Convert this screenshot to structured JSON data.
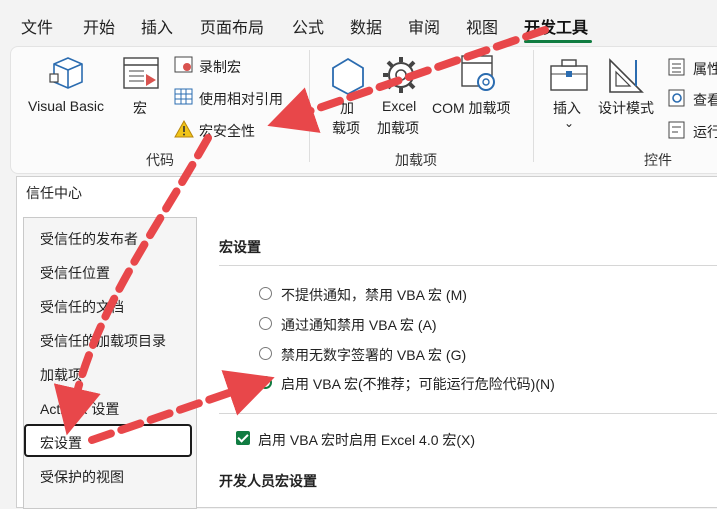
{
  "menubar": {
    "tabs": [
      "文件",
      "开始",
      "插入",
      "页面布局",
      "公式",
      "数据",
      "审阅",
      "视图",
      "开发工具"
    ],
    "active_tab": "开发工具"
  },
  "ribbon": {
    "code": {
      "visual_basic": "Visual Basic",
      "macros": "宏",
      "record_macro": "录制宏",
      "relative_ref": "使用相对引用",
      "macro_security": "宏安全性",
      "group_label": "代码"
    },
    "addins": {
      "addins_line1": "加",
      "addins_line2": "载项",
      "excel_addins_line1": "Excel",
      "excel_addins_line2": "加载项",
      "com_addins": "COM 加载项",
      "group_label": "加载项"
    },
    "controls": {
      "insert": "插入",
      "design_mode": "设计模式",
      "properties": "属性",
      "view_code": "查看",
      "run_dialog": "运行",
      "group_label": "控件"
    }
  },
  "dialog": {
    "title": "信任中心",
    "nav_items": [
      "受信任的发布者",
      "受信任位置",
      "受信任的文档",
      "受信任的加载项目录",
      "加载项",
      "ActiveX 设置",
      "宏设置",
      "受保护的视图"
    ],
    "selected_nav": "宏设置",
    "macro_settings_title": "宏设置",
    "options": [
      "不提供通知，禁用 VBA 宏 (M)",
      "通过通知禁用 VBA 宏 (A)",
      "禁用无数字签署的 VBA 宏 (G)",
      "启用 VBA 宏(不推荐；可能运行危险代码)(N)"
    ],
    "selected_option_index": 3,
    "excel4_checkbox": "启用 VBA 宏时启用 Excel 4.0 宏(X)",
    "excel4_checked": true,
    "dev_settings_title": "开发人员宏设置"
  },
  "colors": {
    "accent": "#107c41",
    "arrow": "#e8474a"
  }
}
